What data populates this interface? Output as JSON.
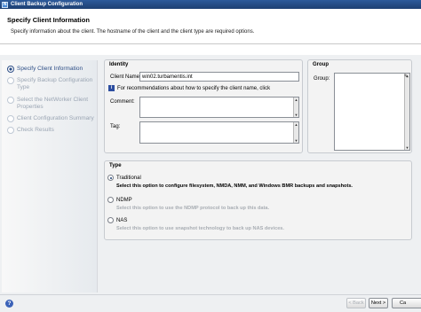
{
  "window": {
    "title": "Client Backup Configuration"
  },
  "header": {
    "title": "Specify Client Information",
    "description": "Specify information about the client.  The hostname of the client and the client type are required options."
  },
  "steps": [
    {
      "label": "Specify Client Information",
      "state": "active"
    },
    {
      "label": "Specify Backup Configuration Type",
      "state": "pending"
    },
    {
      "label": "Select the NetWorker Client Properties",
      "state": "pending"
    },
    {
      "label": "Client Configuration Summary",
      "state": "pending"
    },
    {
      "label": "Check Results",
      "state": "pending"
    }
  ],
  "identity": {
    "title": "Identity",
    "client_name_label": "Client Name:",
    "client_name_value": "win02.turbamentis.int",
    "info_text": "For recommendations about how to specify the client name, click",
    "comment_label": "Comment:",
    "tag_label": "Tag:"
  },
  "group": {
    "title": "Group",
    "group_label": "Group:"
  },
  "type": {
    "title": "Type",
    "options": [
      {
        "label": "Traditional",
        "selected": true,
        "description": "Select this option to configure filesystem, NMDA, NMM, and Windows BMR backups and snapshots."
      },
      {
        "label": "NDMP",
        "selected": false,
        "description": "Select this option to use the NDMP protocol to back up this data."
      },
      {
        "label": "NAS",
        "selected": false,
        "description": "Select this option to use snapshot technology to back up NAS devices."
      }
    ]
  },
  "footer": {
    "help_label": "?",
    "back_label": "< Back",
    "next_label": "Next >",
    "cancel_label": "Ca"
  },
  "colors": {
    "accent": "#2d4e86",
    "titlebar": "#1d3f72"
  }
}
